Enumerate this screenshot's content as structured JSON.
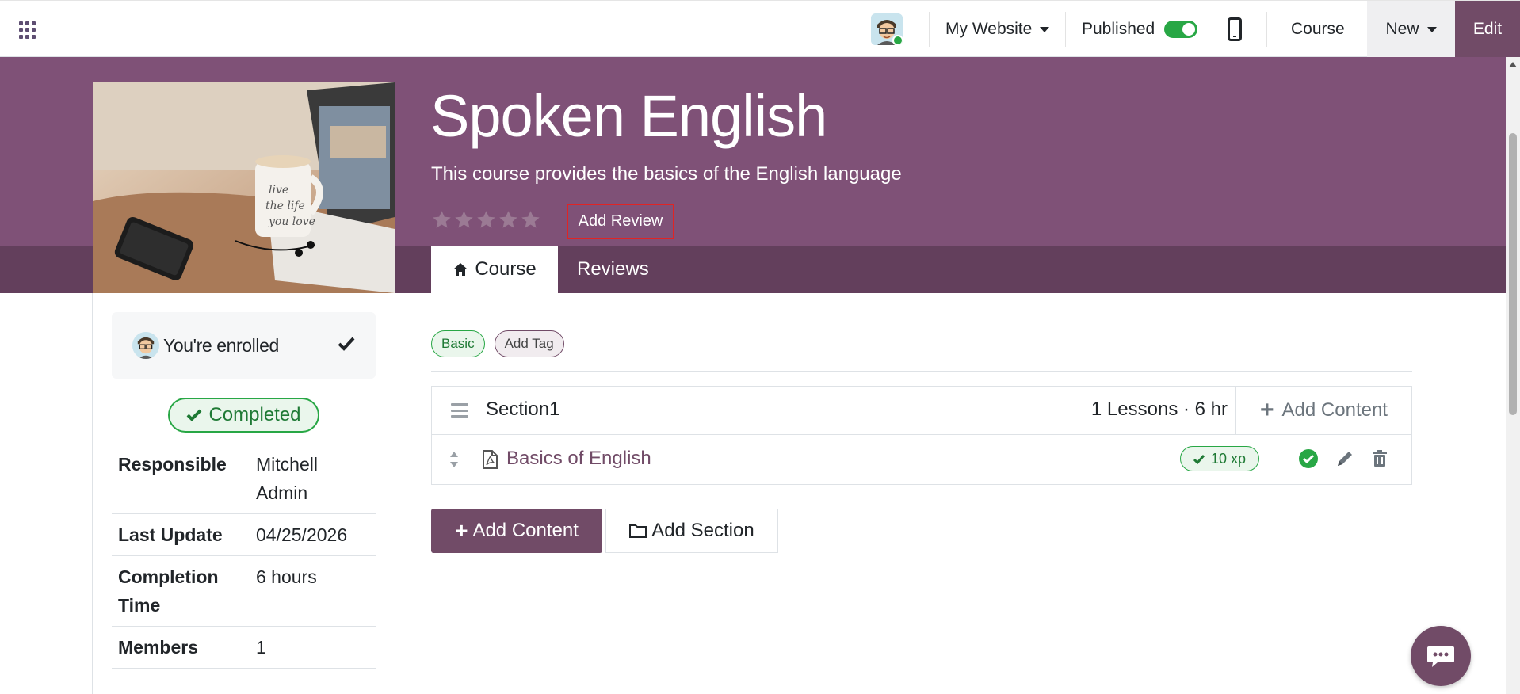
{
  "topbar": {
    "website_label": "My Website",
    "published_label": "Published",
    "published": true,
    "course_label": "Course",
    "new_label": "New",
    "edit_label": "Edit"
  },
  "course": {
    "title": "Spoken English",
    "description": "This course provides the basics of the English language",
    "rating_stars": 0,
    "add_review_label": "Add Review",
    "tabs": [
      {
        "label": "Course",
        "active": true
      },
      {
        "label": "Reviews",
        "active": false
      }
    ]
  },
  "sidebar": {
    "enrolled_text": "You're enrolled",
    "completed_label": "Completed",
    "info": [
      {
        "key": "Responsible",
        "value": "Mitchell Admin"
      },
      {
        "key": "Last Update",
        "value": "04/25/2026"
      },
      {
        "key": "Completion Time",
        "value": "6 hours"
      },
      {
        "key": "Members",
        "value": "1"
      }
    ]
  },
  "tags": {
    "basic": "Basic",
    "add_tag": "Add Tag"
  },
  "section": {
    "title": "Section1",
    "meta": "1 Lessons · 6 hr",
    "add_content_label": "Add Content",
    "lessons": [
      {
        "title": "Basics of English",
        "xp": "10 xp",
        "completed": true
      }
    ]
  },
  "actions": {
    "add_content": "Add Content",
    "add_section": "Add Section"
  },
  "colors": {
    "primary": "#714b67",
    "hero": "#7f5177",
    "success": "#28a745"
  }
}
